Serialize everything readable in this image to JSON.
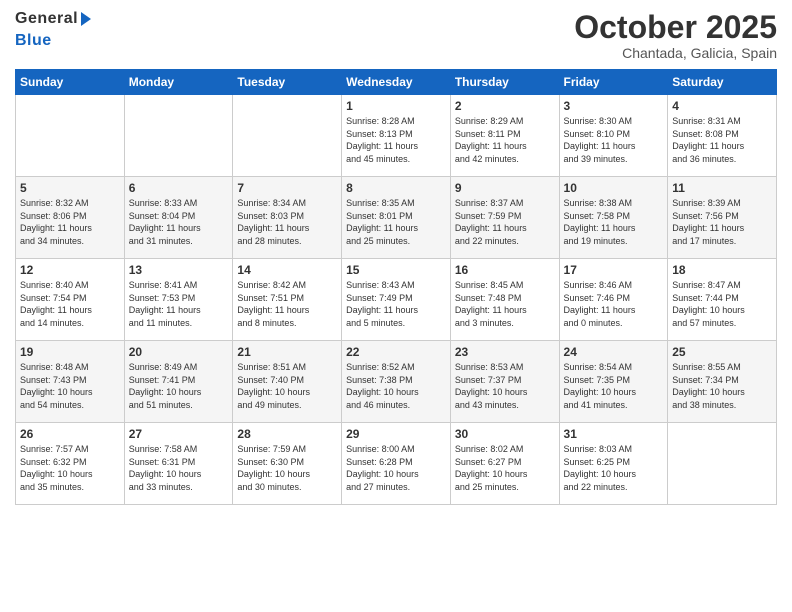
{
  "logo": {
    "line1": "General",
    "line2": "Blue"
  },
  "title": "October 2025",
  "subtitle": "Chantada, Galicia, Spain",
  "days_of_week": [
    "Sunday",
    "Monday",
    "Tuesday",
    "Wednesday",
    "Thursday",
    "Friday",
    "Saturday"
  ],
  "weeks": [
    [
      {
        "day": "",
        "info": ""
      },
      {
        "day": "",
        "info": ""
      },
      {
        "day": "",
        "info": ""
      },
      {
        "day": "1",
        "info": "Sunrise: 8:28 AM\nSunset: 8:13 PM\nDaylight: 11 hours\nand 45 minutes."
      },
      {
        "day": "2",
        "info": "Sunrise: 8:29 AM\nSunset: 8:11 PM\nDaylight: 11 hours\nand 42 minutes."
      },
      {
        "day": "3",
        "info": "Sunrise: 8:30 AM\nSunset: 8:10 PM\nDaylight: 11 hours\nand 39 minutes."
      },
      {
        "day": "4",
        "info": "Sunrise: 8:31 AM\nSunset: 8:08 PM\nDaylight: 11 hours\nand 36 minutes."
      }
    ],
    [
      {
        "day": "5",
        "info": "Sunrise: 8:32 AM\nSunset: 8:06 PM\nDaylight: 11 hours\nand 34 minutes."
      },
      {
        "day": "6",
        "info": "Sunrise: 8:33 AM\nSunset: 8:04 PM\nDaylight: 11 hours\nand 31 minutes."
      },
      {
        "day": "7",
        "info": "Sunrise: 8:34 AM\nSunset: 8:03 PM\nDaylight: 11 hours\nand 28 minutes."
      },
      {
        "day": "8",
        "info": "Sunrise: 8:35 AM\nSunset: 8:01 PM\nDaylight: 11 hours\nand 25 minutes."
      },
      {
        "day": "9",
        "info": "Sunrise: 8:37 AM\nSunset: 7:59 PM\nDaylight: 11 hours\nand 22 minutes."
      },
      {
        "day": "10",
        "info": "Sunrise: 8:38 AM\nSunset: 7:58 PM\nDaylight: 11 hours\nand 19 minutes."
      },
      {
        "day": "11",
        "info": "Sunrise: 8:39 AM\nSunset: 7:56 PM\nDaylight: 11 hours\nand 17 minutes."
      }
    ],
    [
      {
        "day": "12",
        "info": "Sunrise: 8:40 AM\nSunset: 7:54 PM\nDaylight: 11 hours\nand 14 minutes."
      },
      {
        "day": "13",
        "info": "Sunrise: 8:41 AM\nSunset: 7:53 PM\nDaylight: 11 hours\nand 11 minutes."
      },
      {
        "day": "14",
        "info": "Sunrise: 8:42 AM\nSunset: 7:51 PM\nDaylight: 11 hours\nand 8 minutes."
      },
      {
        "day": "15",
        "info": "Sunrise: 8:43 AM\nSunset: 7:49 PM\nDaylight: 11 hours\nand 5 minutes."
      },
      {
        "day": "16",
        "info": "Sunrise: 8:45 AM\nSunset: 7:48 PM\nDaylight: 11 hours\nand 3 minutes."
      },
      {
        "day": "17",
        "info": "Sunrise: 8:46 AM\nSunset: 7:46 PM\nDaylight: 11 hours\nand 0 minutes."
      },
      {
        "day": "18",
        "info": "Sunrise: 8:47 AM\nSunset: 7:44 PM\nDaylight: 10 hours\nand 57 minutes."
      }
    ],
    [
      {
        "day": "19",
        "info": "Sunrise: 8:48 AM\nSunset: 7:43 PM\nDaylight: 10 hours\nand 54 minutes."
      },
      {
        "day": "20",
        "info": "Sunrise: 8:49 AM\nSunset: 7:41 PM\nDaylight: 10 hours\nand 51 minutes."
      },
      {
        "day": "21",
        "info": "Sunrise: 8:51 AM\nSunset: 7:40 PM\nDaylight: 10 hours\nand 49 minutes."
      },
      {
        "day": "22",
        "info": "Sunrise: 8:52 AM\nSunset: 7:38 PM\nDaylight: 10 hours\nand 46 minutes."
      },
      {
        "day": "23",
        "info": "Sunrise: 8:53 AM\nSunset: 7:37 PM\nDaylight: 10 hours\nand 43 minutes."
      },
      {
        "day": "24",
        "info": "Sunrise: 8:54 AM\nSunset: 7:35 PM\nDaylight: 10 hours\nand 41 minutes."
      },
      {
        "day": "25",
        "info": "Sunrise: 8:55 AM\nSunset: 7:34 PM\nDaylight: 10 hours\nand 38 minutes."
      }
    ],
    [
      {
        "day": "26",
        "info": "Sunrise: 7:57 AM\nSunset: 6:32 PM\nDaylight: 10 hours\nand 35 minutes."
      },
      {
        "day": "27",
        "info": "Sunrise: 7:58 AM\nSunset: 6:31 PM\nDaylight: 10 hours\nand 33 minutes."
      },
      {
        "day": "28",
        "info": "Sunrise: 7:59 AM\nSunset: 6:30 PM\nDaylight: 10 hours\nand 30 minutes."
      },
      {
        "day": "29",
        "info": "Sunrise: 8:00 AM\nSunset: 6:28 PM\nDaylight: 10 hours\nand 27 minutes."
      },
      {
        "day": "30",
        "info": "Sunrise: 8:02 AM\nSunset: 6:27 PM\nDaylight: 10 hours\nand 25 minutes."
      },
      {
        "day": "31",
        "info": "Sunrise: 8:03 AM\nSunset: 6:25 PM\nDaylight: 10 hours\nand 22 minutes."
      },
      {
        "day": "",
        "info": ""
      }
    ]
  ]
}
